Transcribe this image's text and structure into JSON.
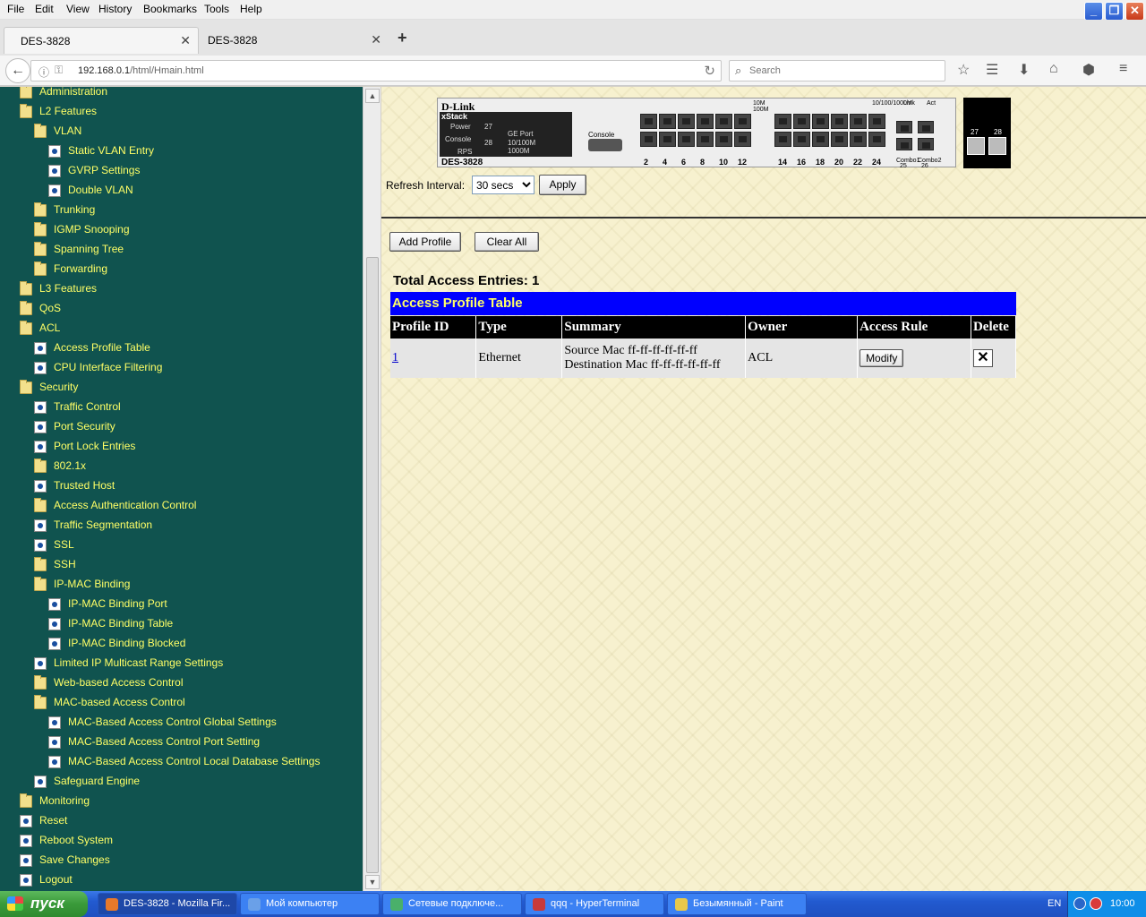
{
  "browser": {
    "menu": [
      "File",
      "Edit",
      "View",
      "History",
      "Bookmarks",
      "Tools",
      "Help"
    ],
    "menu_underline": [
      "F",
      "E",
      "V",
      "s",
      "B",
      "T",
      "H"
    ],
    "tabs": [
      {
        "title": "DES-3828",
        "close": "✕"
      },
      {
        "title": "DES-3828",
        "close": "✕"
      }
    ],
    "new_tab": "+",
    "url_prefix": "192.168.0.1",
    "url_path": "/html/Hmain.html",
    "search_placeholder": "Search",
    "window_controls": {
      "minimize": "_",
      "maximize": "❐",
      "close": "✕"
    }
  },
  "tree": {
    "items": [
      {
        "label": "Administration",
        "icon": "folder-icon",
        "level": 1
      },
      {
        "label": "L2 Features",
        "icon": "folder-open-icon",
        "level": 1
      },
      {
        "label": "VLAN",
        "icon": "folder-open-icon",
        "level": 2
      },
      {
        "label": "Static VLAN Entry",
        "icon": "page-icon",
        "level": 3
      },
      {
        "label": "GVRP Settings",
        "icon": "page-icon",
        "level": 3
      },
      {
        "label": "Double VLAN",
        "icon": "page-icon",
        "level": 3
      },
      {
        "label": "Trunking",
        "icon": "folder-icon",
        "level": 2
      },
      {
        "label": "IGMP Snooping",
        "icon": "folder-icon",
        "level": 2
      },
      {
        "label": "Spanning Tree",
        "icon": "folder-icon",
        "level": 2
      },
      {
        "label": "Forwarding",
        "icon": "folder-icon",
        "level": 2
      },
      {
        "label": "L3 Features",
        "icon": "folder-icon",
        "level": 1
      },
      {
        "label": "QoS",
        "icon": "folder-icon",
        "level": 1
      },
      {
        "label": "ACL",
        "icon": "folder-open-icon",
        "level": 1
      },
      {
        "label": "Access Profile Table",
        "icon": "page-icon",
        "level": 2
      },
      {
        "label": "CPU Interface Filtering",
        "icon": "page-icon",
        "level": 2
      },
      {
        "label": "Security",
        "icon": "folder-open-icon",
        "level": 1
      },
      {
        "label": "Traffic Control",
        "icon": "page-icon",
        "level": 2
      },
      {
        "label": "Port Security",
        "icon": "page-icon",
        "level": 2
      },
      {
        "label": "Port Lock Entries",
        "icon": "page-icon",
        "level": 2
      },
      {
        "label": "802.1x",
        "icon": "folder-icon",
        "level": 2
      },
      {
        "label": "Trusted Host",
        "icon": "page-icon",
        "level": 2
      },
      {
        "label": "Access Authentication Control",
        "icon": "folder-icon",
        "level": 2
      },
      {
        "label": "Traffic Segmentation",
        "icon": "page-icon",
        "level": 2
      },
      {
        "label": "SSL",
        "icon": "page-icon",
        "level": 2
      },
      {
        "label": "SSH",
        "icon": "folder-icon",
        "level": 2
      },
      {
        "label": "IP-MAC Binding",
        "icon": "folder-open-icon",
        "level": 2
      },
      {
        "label": "IP-MAC Binding Port",
        "icon": "page-icon",
        "level": 3
      },
      {
        "label": "IP-MAC Binding Table",
        "icon": "page-icon",
        "level": 3
      },
      {
        "label": "IP-MAC Binding Blocked",
        "icon": "page-icon",
        "level": 3
      },
      {
        "label": "Limited IP Multicast Range Settings",
        "icon": "page-icon",
        "level": 2
      },
      {
        "label": "Web-based Access Control",
        "icon": "folder-icon",
        "level": 2
      },
      {
        "label": "MAC-based Access Control",
        "icon": "folder-open-icon",
        "level": 2
      },
      {
        "label": "MAC-Based Access Control Global Settings",
        "icon": "page-icon",
        "level": 3
      },
      {
        "label": "MAC-Based Access Control Port Setting",
        "icon": "page-icon",
        "level": 3
      },
      {
        "label": "MAC-Based Access Control Local Database Settings",
        "icon": "page-icon",
        "level": 3
      },
      {
        "label": "Safeguard Engine",
        "icon": "page-icon",
        "level": 2
      },
      {
        "label": "Monitoring",
        "icon": "folder-icon",
        "level": 1
      },
      {
        "label": "Reset",
        "icon": "page-icon",
        "level": 1
      },
      {
        "label": "Reboot System",
        "icon": "page-icon",
        "level": 1
      },
      {
        "label": "Save Changes",
        "icon": "page-icon",
        "level": 1
      },
      {
        "label": "Logout",
        "icon": "page-icon",
        "level": 1
      }
    ]
  },
  "device": {
    "brand": "D-Link",
    "stack": "xStack",
    "model": "DES-3828",
    "power": "Power",
    "console_led": "Console",
    "rps": "RPS",
    "ge_port": "GE Port",
    "p27": "27",
    "p28": "28",
    "speed_10_100": "10/100M",
    "speed_1000": "1000M",
    "console": "Console",
    "led_10m": "10M",
    "led_100m": "100M",
    "led_10_100_1000": "10/100/1000M",
    "led_link": "Link",
    "led_act": "Act",
    "combo1": "Combo1",
    "combo2": "Combo2",
    "port_numbers": [
      "2",
      "4",
      "6",
      "8",
      "10",
      "12",
      "14",
      "16",
      "18",
      "20",
      "22",
      "24"
    ],
    "combo_nums": [
      "25",
      "26"
    ],
    "end_ports": [
      "27",
      "28"
    ]
  },
  "refresh": {
    "label": "Refresh Interval:",
    "value": "30 secs",
    "apply": "Apply"
  },
  "actions": {
    "add_profile": "Add Profile",
    "clear_all": "Clear All"
  },
  "acl": {
    "total": "Total Access Entries: 1",
    "table_title": "Access Profile Table",
    "headers": [
      "Profile ID",
      "Type",
      "Summary",
      "Owner",
      "Access Rule",
      "Delete"
    ],
    "rows": [
      {
        "profile_id": "1",
        "type": "Ethernet",
        "summary_1": "Source Mac ff-ff-ff-ff-ff-ff",
        "summary_2": "Destination Mac ff-ff-ff-ff-ff-ff",
        "owner": "ACL",
        "modify": "Modify",
        "delete": "✕"
      }
    ]
  },
  "taskbar": {
    "start": "пуск",
    "tasks": [
      {
        "label": "DES-3828 - Mozilla Fir...",
        "color": "#e8792a"
      },
      {
        "label": "Мой компьютер",
        "color": "#6aa0e8"
      },
      {
        "label": "Сетевые подключе...",
        "color": "#4ab06a"
      },
      {
        "label": "qqq - HyperTerminal",
        "color": "#c83a3a"
      },
      {
        "label": "Безымянный - Paint",
        "color": "#e8c84a"
      }
    ],
    "lang": "EN",
    "clock": "10:00"
  }
}
